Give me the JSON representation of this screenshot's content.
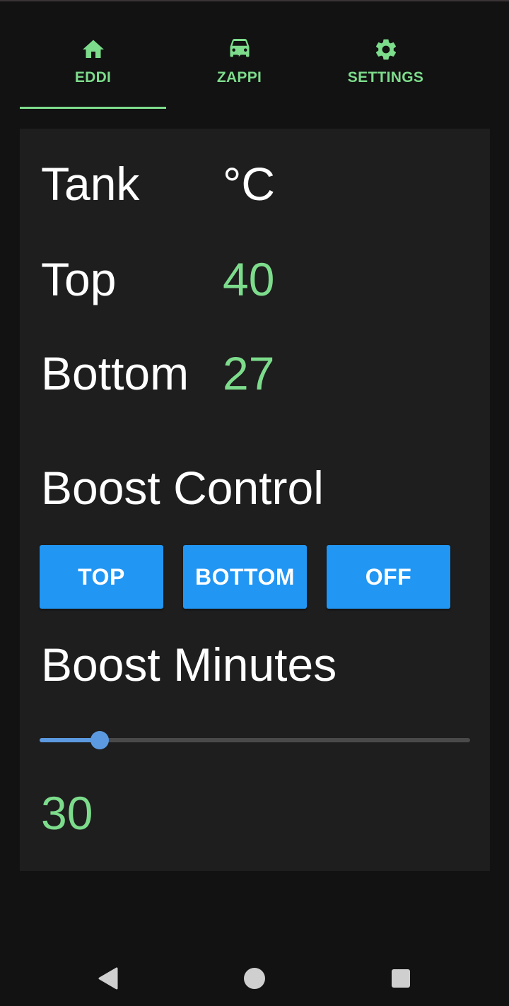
{
  "tabs": [
    {
      "label": "EDDI",
      "icon": "home-icon",
      "selected": true
    },
    {
      "label": "ZAPPI",
      "icon": "ev-car-icon",
      "selected": false
    },
    {
      "label": "SETTINGS",
      "icon": "gear-icon",
      "selected": false
    }
  ],
  "tank": {
    "header_label": "Tank",
    "unit": "°C",
    "top_label": "Top",
    "top_value": "40",
    "bottom_label": "Bottom",
    "bottom_value": "27"
  },
  "boost_control": {
    "title": "Boost Control",
    "buttons": [
      "TOP",
      "BOTTOM",
      "OFF"
    ]
  },
  "boost_minutes": {
    "title": "Boost Minutes",
    "value": "30",
    "slider_fraction": 0.14
  },
  "colors": {
    "accent_green": "#7ddc8c",
    "button_blue": "#2196f3",
    "slider_blue": "#5b9ae0",
    "background": "#121212",
    "card": "#1e1e1e"
  },
  "system_nav": [
    "back-icon",
    "home-circle-icon",
    "recents-icon"
  ]
}
